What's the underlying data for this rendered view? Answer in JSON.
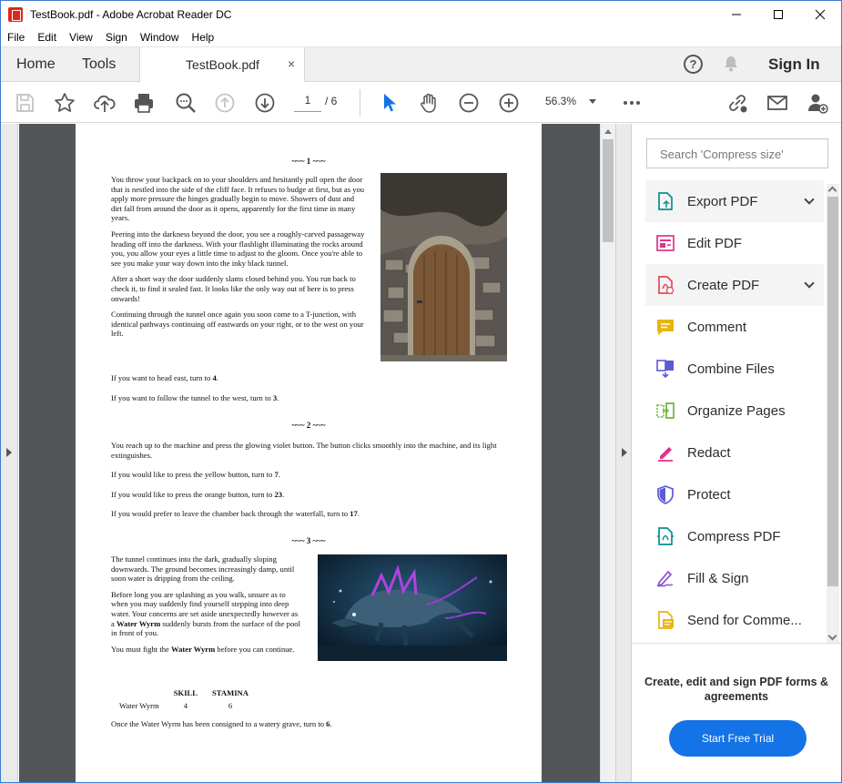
{
  "window": {
    "title": "TestBook.pdf - Adobe Acrobat Reader DC"
  },
  "menu": [
    "File",
    "Edit",
    "View",
    "Sign",
    "Window",
    "Help"
  ],
  "tabs": {
    "home": "Home",
    "tools": "Tools",
    "document": "TestBook.pdf",
    "close": "×"
  },
  "header": {
    "sign_in": "Sign In",
    "help": "?"
  },
  "toolbar": {
    "page_current": "1",
    "page_total": "/ 6",
    "zoom": "56.3%"
  },
  "document": {
    "sections": [
      {
        "heading": "~~~ 1 ~~~",
        "paragraphs": [
          "You throw your backpack on to your shoulders and hesitantly pull open the door that is nestled into the side of the cliff face. It refuses to budge at first, but as you apply more pressure the hinges gradually begin to move. Showers of dust and dirt fall from around the door as it opens, apparently for the first time in many years.",
          "Peering into the darkness beyond the door, you see a roughly-carved passageway heading off into the darkness. With your flashlight illuminating the rocks around you, you allow your eyes a little time to adjust to the gloom. Once you're able to see you make your way down into the inky black tunnel.",
          "After a short way the door suddenly slams closed behind you. You run back to check it, to find it sealed fast. It looks like the only way out of here is to press onwards!",
          "Continuing through the tunnel once again you soon come to a T-junction, with identical pathways continuing off eastwards on your right, or to the west on your left."
        ],
        "choices": [
          {
            "text": "If you want to head east, turn to ",
            "num": "4",
            "end": "."
          },
          {
            "text": "If you want to follow the tunnel to the west, turn to ",
            "num": "3",
            "end": "."
          }
        ]
      },
      {
        "heading": "~~~ 2 ~~~",
        "paragraphs": [
          "You reach up to the machine and press the glowing violet button. The button clicks smoothly into the machine, and its light extinguishes."
        ],
        "choices": [
          {
            "text": "If you would like to press the yellow button, turn to ",
            "num": "7",
            "end": "."
          },
          {
            "text": "If you would like to press the orange button, turn to ",
            "num": "23",
            "end": "."
          },
          {
            "text": "If you would prefer to leave the chamber back through the waterfall, turn to ",
            "num": "17",
            "end": "."
          }
        ]
      },
      {
        "heading": "~~~ 3 ~~~",
        "p1": "The tunnel continues into the dark, gradually sloping downwards. The ground becomes increasingly damp, until soon water is dripping from the ceiling.",
        "p2a": "Before long you are splashing as you walk, unsure as to when you may suddenly find yourself stepping into deep water. Your concerns are set aside unexpectedly however as a ",
        "p2b": "Water Wyrm",
        "p2c": " suddenly bursts from the surface of the pool in front of you.",
        "p3a": "You must fight the ",
        "p3b": "Water Wyrm",
        "p3c": " before you can continue.",
        "stats": {
          "h_skill": "SKILL",
          "h_stamina": "STAMINA",
          "name": "Water Wyrm",
          "skill": "4",
          "stamina": "6"
        },
        "p4a": "Once the Water Wyrm has been consigned to a watery grave, turn to ",
        "p4b": "6",
        "p4c": "."
      }
    ]
  },
  "right_pane": {
    "search_placeholder": "Search 'Compress size'",
    "tools": [
      {
        "label": "Export PDF",
        "icon": "export-pdf-icon",
        "color": "#0a8f8f"
      },
      {
        "label": "Edit PDF",
        "icon": "edit-pdf-icon",
        "color": "#e0338c"
      },
      {
        "label": "Create PDF",
        "icon": "create-pdf-icon",
        "color": "#e34850"
      },
      {
        "label": "Comment",
        "icon": "comment-icon",
        "color": "#e8b50c"
      },
      {
        "label": "Combine Files",
        "icon": "combine-files-icon",
        "color": "#5b5bd6"
      },
      {
        "label": "Organize Pages",
        "icon": "organize-pages-icon",
        "color": "#6bb43c"
      },
      {
        "label": "Redact",
        "icon": "redact-icon",
        "color": "#e0338c"
      },
      {
        "label": "Protect",
        "icon": "protect-icon",
        "color": "#5b5bd6"
      },
      {
        "label": "Compress PDF",
        "icon": "compress-pdf-icon",
        "color": "#0a8f8f"
      },
      {
        "label": "Fill & Sign",
        "icon": "fill-sign-icon",
        "color": "#8a4fd8"
      },
      {
        "label": "Send for Comme...",
        "icon": "send-for-comment-icon",
        "color": "#e8b50c"
      }
    ],
    "promo_text": "Create, edit and sign PDF forms & agreements",
    "promo_button": "Start Free Trial"
  }
}
